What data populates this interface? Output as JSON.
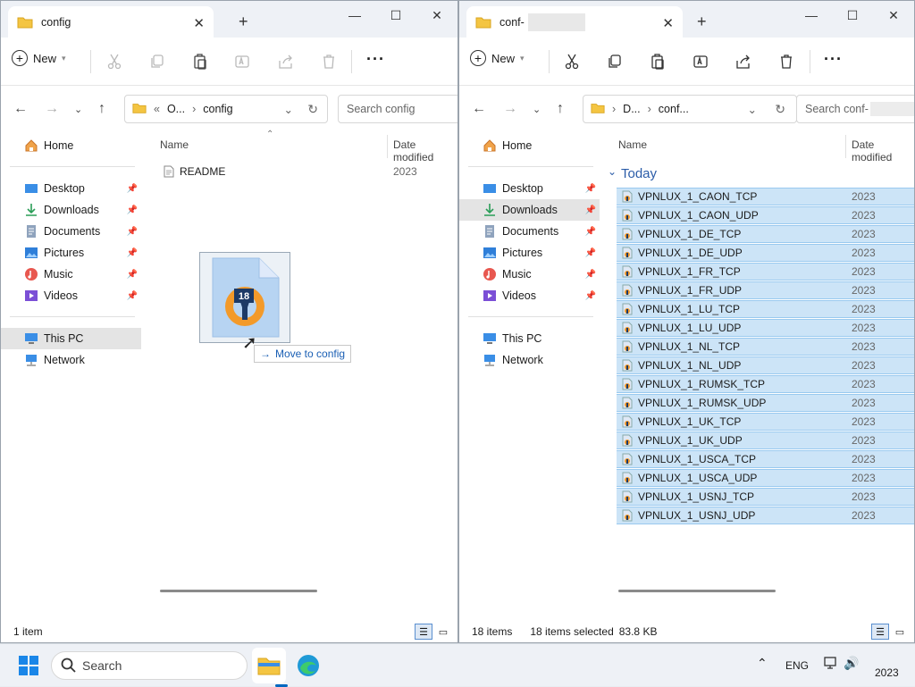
{
  "left_window": {
    "tab_title": "config",
    "toolbar": {
      "new_label": "New"
    },
    "address": {
      "ellipsis": "«",
      "segment1": "O...",
      "segment2": "config"
    },
    "search_placeholder": "Search config",
    "sidebar": {
      "home": "Home",
      "quick": [
        "Desktop",
        "Downloads",
        "Documents",
        "Pictures",
        "Music",
        "Videos"
      ],
      "this_pc": "This PC",
      "network": "Network"
    },
    "columns": {
      "name": "Name",
      "date": "Date modified"
    },
    "files": [
      {
        "name": "README",
        "date": "2023"
      }
    ],
    "status": {
      "count": "1 item"
    },
    "drag": {
      "badge": "18",
      "tooltip": "Move to config"
    }
  },
  "right_window": {
    "tab_title": "conf-",
    "toolbar": {
      "new_label": "New"
    },
    "address": {
      "segment1": "D...",
      "segment2": "conf..."
    },
    "search_placeholder": "Search conf-",
    "sidebar": {
      "home": "Home",
      "quick": [
        "Desktop",
        "Downloads",
        "Documents",
        "Pictures",
        "Music",
        "Videos"
      ],
      "this_pc": "This PC",
      "network": "Network"
    },
    "columns": {
      "name": "Name",
      "date": "Date modified"
    },
    "group_label": "Today",
    "files": [
      {
        "name": "VPNLUX_1_CAON_TCP",
        "date": "2023"
      },
      {
        "name": "VPNLUX_1_CAON_UDP",
        "date": "2023"
      },
      {
        "name": "VPNLUX_1_DE_TCP",
        "date": "2023"
      },
      {
        "name": "VPNLUX_1_DE_UDP",
        "date": "2023"
      },
      {
        "name": "VPNLUX_1_FR_TCP",
        "date": "2023"
      },
      {
        "name": "VPNLUX_1_FR_UDP",
        "date": "2023"
      },
      {
        "name": "VPNLUX_1_LU_TCP",
        "date": "2023"
      },
      {
        "name": "VPNLUX_1_LU_UDP",
        "date": "2023"
      },
      {
        "name": "VPNLUX_1_NL_TCP",
        "date": "2023"
      },
      {
        "name": "VPNLUX_1_NL_UDP",
        "date": "2023"
      },
      {
        "name": "VPNLUX_1_RUMSK_TCP",
        "date": "2023"
      },
      {
        "name": "VPNLUX_1_RUMSK_UDP",
        "date": "2023"
      },
      {
        "name": "VPNLUX_1_UK_TCP",
        "date": "2023"
      },
      {
        "name": "VPNLUX_1_UK_UDP",
        "date": "2023"
      },
      {
        "name": "VPNLUX_1_USCA_TCP",
        "date": "2023"
      },
      {
        "name": "VPNLUX_1_USCA_UDP",
        "date": "2023"
      },
      {
        "name": "VPNLUX_1_USNJ_TCP",
        "date": "2023"
      },
      {
        "name": "VPNLUX_1_USNJ_UDP",
        "date": "2023"
      }
    ],
    "status": {
      "count": "18 items",
      "selected": "18 items selected",
      "size": "83.8 KB"
    }
  },
  "taskbar": {
    "search_label": "Search",
    "lang": "ENG",
    "clock": "2023"
  },
  "colors": {
    "folder": "#f4c542",
    "selection": "#cce4f7",
    "accent": "#0067c0"
  }
}
